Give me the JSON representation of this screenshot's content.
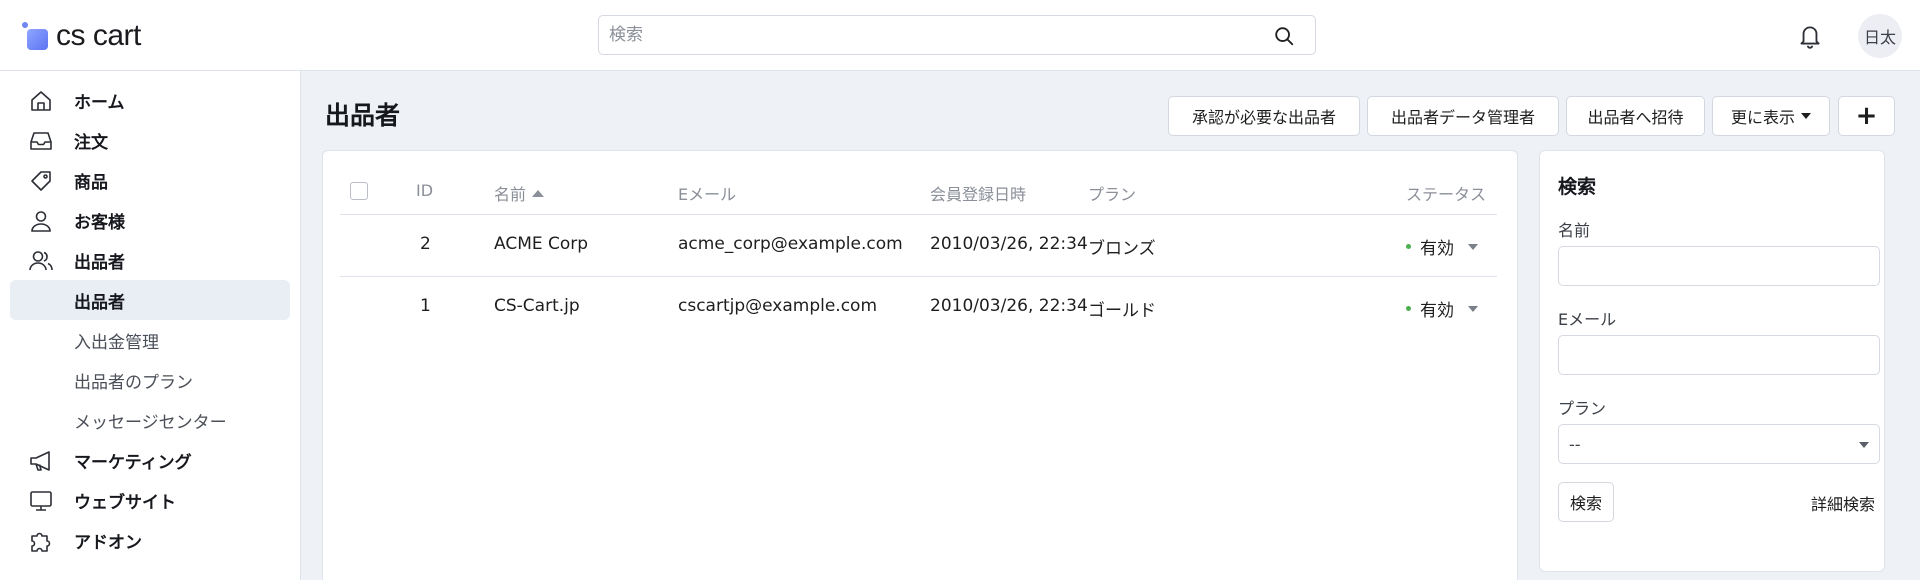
{
  "header": {
    "logo_text": "cs cart",
    "search_placeholder": "検索",
    "avatar_initials": "日太"
  },
  "sidebar": {
    "items": [
      {
        "label": "ホーム",
        "icon": "home-icon"
      },
      {
        "label": "注文",
        "icon": "inbox-icon"
      },
      {
        "label": "商品",
        "icon": "tag-icon"
      },
      {
        "label": "お客様",
        "icon": "user-icon"
      },
      {
        "label": "出品者",
        "icon": "users-icon"
      },
      {
        "label": "マーケティング",
        "icon": "megaphone-icon"
      },
      {
        "label": "ウェブサイト",
        "icon": "monitor-icon"
      },
      {
        "label": "アドオン",
        "icon": "puzzle-icon"
      }
    ],
    "subitems": [
      {
        "label": "出品者",
        "active": true
      },
      {
        "label": "入出金管理",
        "active": false
      },
      {
        "label": "出品者のプラン",
        "active": false
      },
      {
        "label": "メッセージセンター",
        "active": false
      }
    ]
  },
  "page": {
    "title": "出品者",
    "actions": {
      "approval": "承認が必要な出品者",
      "admins": "出品者データ管理者",
      "invite": "出品者へ招待",
      "more": "更に表示",
      "add": "+"
    }
  },
  "table": {
    "columns": {
      "id": "ID",
      "name": "名前",
      "email": "Eメール",
      "date": "会員登録日時",
      "plan": "プラン",
      "status": "ステータス"
    },
    "rows": [
      {
        "id": "2",
        "name": "ACME Corp",
        "email": "acme_corp@example.com",
        "date": "2010/03/26, 22:34",
        "plan": "ブロンズ",
        "status": "有効"
      },
      {
        "id": "1",
        "name": "CS-Cart.jp",
        "email": "cscartjp@example.com",
        "date": "2010/03/26, 22:34",
        "plan": "ゴールド",
        "status": "有効"
      }
    ]
  },
  "search_panel": {
    "title": "検索",
    "name_label": "名前",
    "email_label": "Eメール",
    "plan_label": "プラン",
    "plan_value": "--",
    "search_button": "検索",
    "advanced_link": "詳細検索"
  },
  "colors": {
    "status_active": "#4caf50",
    "page_background": "#eef1f6",
    "logo_accent": "#6f86f5"
  }
}
